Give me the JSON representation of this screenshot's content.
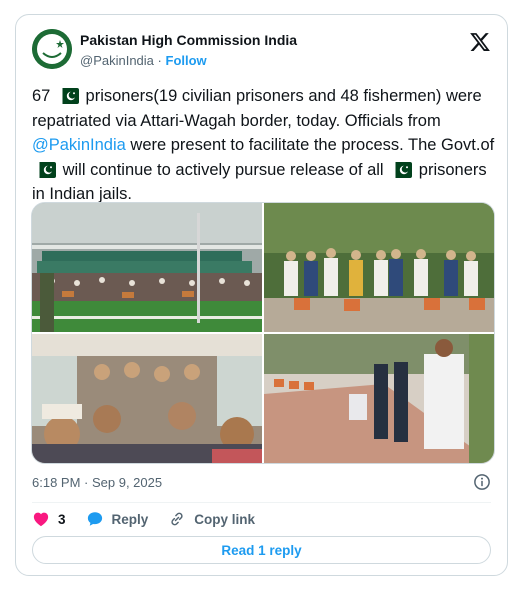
{
  "author": {
    "name": "Pakistan High Commission India",
    "handle": "@PakinIndia",
    "separator": "·",
    "follow_label": "Follow"
  },
  "tweet": {
    "t1": "67",
    "t2": "prisoners(19 civilian prisoners and 48 fishermen) were repatriated via Attari-Wagah border, today. Officials from",
    "mention": "@PakinIndia",
    "t3": "were present to facilitate the process. The Govt.of",
    "t4": "will continue to actively pursue release of all",
    "t5": "prisoners in Indian jails.",
    "flag_icon": "pakistan-flag-emoji"
  },
  "media": {
    "count": 4,
    "items": [
      "stadium-crowd-photo",
      "group-with-luggage-photo",
      "bus-passengers-photo",
      "queue-outdoor-photo"
    ]
  },
  "meta": {
    "timestamp": "6:18 PM · Sep 9, 2025"
  },
  "actions": {
    "like_count": "3",
    "reply_label": "Reply",
    "copy_label": "Copy link",
    "read_replies_label": "Read 1 reply"
  },
  "colors": {
    "link": "#1d9bf0",
    "like": "#f91880",
    "text_secondary": "#536471",
    "border": "#cfd9de",
    "flag_green": "#01411c"
  }
}
